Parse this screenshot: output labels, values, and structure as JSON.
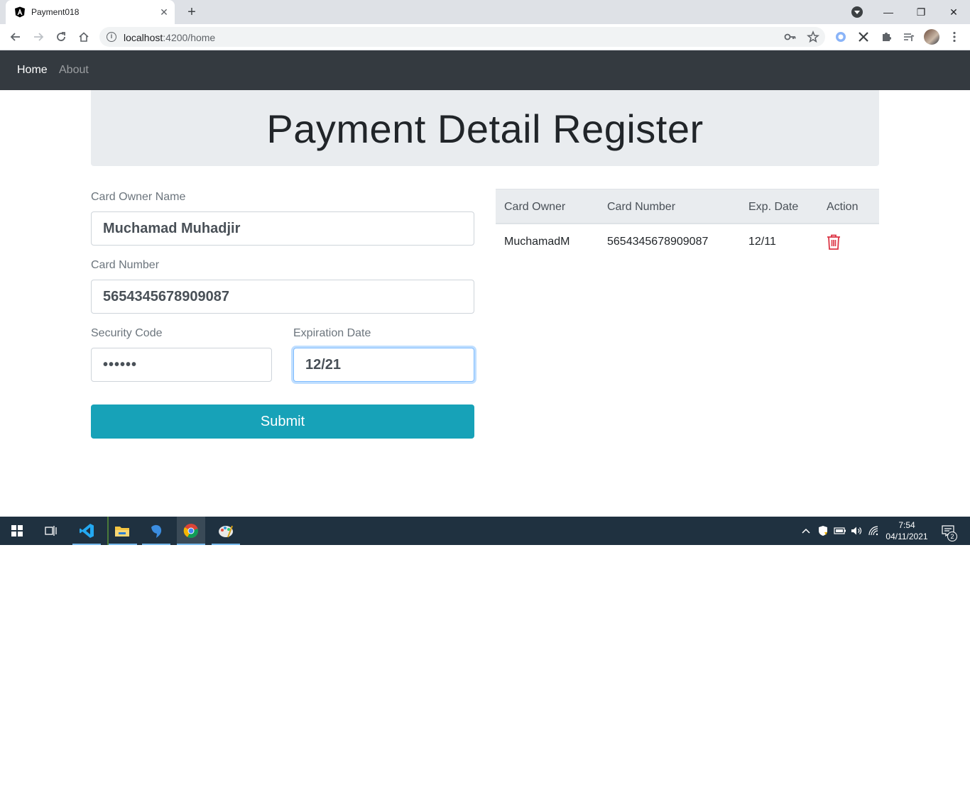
{
  "browser": {
    "tab_title": "Payment018",
    "url_host": "localhost",
    "url_rest": ":4200/home"
  },
  "navbar": {
    "home": "Home",
    "about": "About"
  },
  "header": {
    "title": "Payment Detail Register"
  },
  "form": {
    "owner_label": "Card Owner Name",
    "owner_value": "Muchamad Muhadjir",
    "number_label": "Card Number",
    "number_value": "5654345678909087",
    "cvv_label": "Security Code",
    "cvv_value": "••••••",
    "exp_label": "Expiration Date",
    "exp_value": "12/21",
    "submit_label": "Submit"
  },
  "table": {
    "headers": [
      "Card Owner",
      "Card Number",
      "Exp. Date",
      "Action"
    ],
    "rows": [
      {
        "owner": "MuchamadM",
        "number": "5654345678909087",
        "exp": "12/11"
      }
    ]
  },
  "colors": {
    "accent": "#17a2b8",
    "navbar": "#343a40",
    "danger": "#dc3545",
    "taskbar": "#1f3140"
  },
  "taskbar": {
    "time": "7:54",
    "date": "04/11/2021",
    "notification_count": "2",
    "apps": [
      "start-icon",
      "task-view-icon",
      "vscode-icon",
      "file-explorer-icon",
      "dbeaver-icon",
      "chrome-icon",
      "paint-icon"
    ]
  }
}
